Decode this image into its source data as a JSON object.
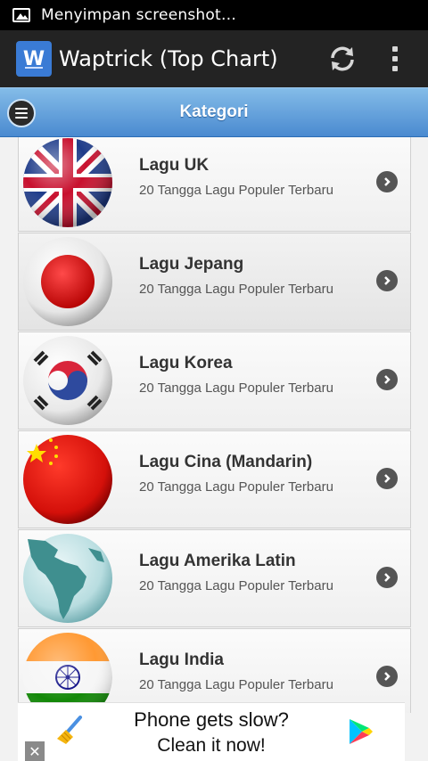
{
  "status_bar": {
    "notification_text": "Menyimpan screenshot…"
  },
  "action_bar": {
    "app_icon_letter": "W",
    "title": "Waptrick (Top Chart)"
  },
  "category_bar": {
    "title": "Kategori"
  },
  "list": {
    "items": [
      {
        "title": "Lagu UK",
        "subtitle": "20 Tangga Lagu Populer Terbaru",
        "flag": "uk-flag"
      },
      {
        "title": "Lagu Jepang",
        "subtitle": "20 Tangga Lagu Populer Terbaru",
        "flag": "japan-flag"
      },
      {
        "title": "Lagu Korea",
        "subtitle": "20 Tangga Lagu Populer Terbaru",
        "flag": "korea-flag"
      },
      {
        "title": "Lagu Cina (Mandarin)",
        "subtitle": "20 Tangga Lagu Populer Terbaru",
        "flag": "china-flag"
      },
      {
        "title": "Lagu Amerika Latin",
        "subtitle": "20 Tangga Lagu Populer Terbaru",
        "flag": "latin-america-globe"
      },
      {
        "title": "Lagu India",
        "subtitle": "20 Tangga Lagu Populer Terbaru",
        "flag": "india-flag"
      }
    ]
  },
  "ad": {
    "line1": "Phone gets slow?",
    "line2": "Clean it now!",
    "close_label": "✕"
  },
  "colors": {
    "header_blue": "#4a8ad0",
    "action_bar": "#232323",
    "list_bg": "#f2f2f2"
  }
}
